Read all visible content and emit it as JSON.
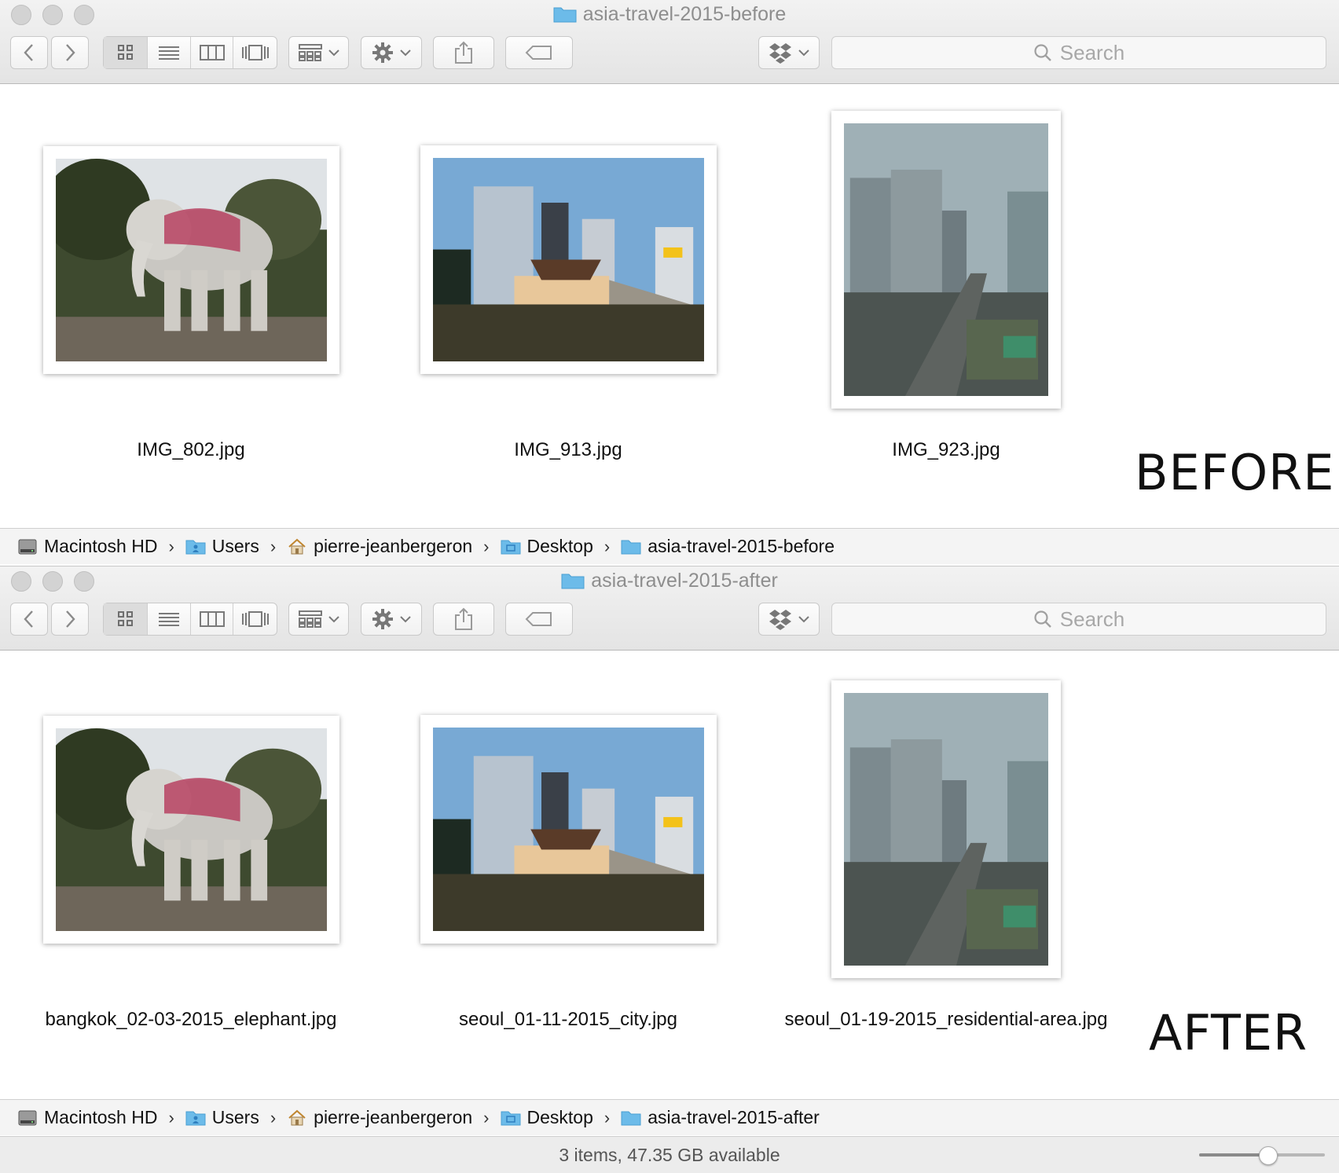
{
  "before": {
    "title": "asia-travel-2015-before",
    "stamp": "BEFORE",
    "search_placeholder": "Search",
    "files": [
      {
        "name": "IMG_802.jpg",
        "photo": "elephant"
      },
      {
        "name": "IMG_913.jpg",
        "photo": "city"
      },
      {
        "name": "IMG_923.jpg",
        "photo": "residential"
      }
    ],
    "path": [
      "Macintosh HD",
      "Users",
      "pierre-jeanbergeron",
      "Desktop",
      "asia-travel-2015-before"
    ]
  },
  "after": {
    "title": "asia-travel-2015-after",
    "stamp": "AFTER",
    "search_placeholder": "Search",
    "files": [
      {
        "name": "bangkok_02-03-2015_elephant.jpg",
        "photo": "elephant"
      },
      {
        "name": "seoul_01-11-2015_city.jpg",
        "photo": "city"
      },
      {
        "name": "seoul_01-19-2015_residential-area.jpg",
        "photo": "residential"
      }
    ],
    "path": [
      "Macintosh HD",
      "Users",
      "pierre-jeanbergeron",
      "Desktop",
      "asia-travel-2015-after"
    ],
    "status": "3 items, 47.35 GB available",
    "icon_size_slider": 0.55
  },
  "path_icons": [
    "hard-drive-icon",
    "users-folder-icon",
    "home-icon",
    "desktop-folder-icon",
    "folder-icon"
  ],
  "colors": {
    "folder_blue": "#6cbbe9",
    "selected_segment": "#dcdcdc"
  }
}
